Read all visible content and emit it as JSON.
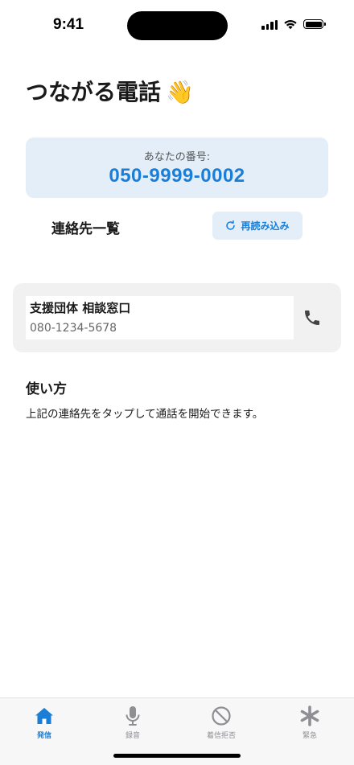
{
  "status_bar": {
    "time": "9:41"
  },
  "app": {
    "title": "つながる電話",
    "title_emoji": "👋"
  },
  "my_number": {
    "label": "あなたの番号:",
    "value": "050-9999-0002"
  },
  "contacts": {
    "heading": "連絡先一覧",
    "reload_label": "再読み込み",
    "items": [
      {
        "name": "支援団体 相談窓口",
        "phone": "080-1234-5678"
      }
    ]
  },
  "usage": {
    "heading": "使い方",
    "text": "上記の連絡先をタップして通話を開始できます。"
  },
  "tab_bar": {
    "tabs": [
      {
        "label": "発信",
        "icon": "home-icon",
        "active": true
      },
      {
        "label": "録音",
        "icon": "microphone-icon",
        "active": false
      },
      {
        "label": "着信拒否",
        "icon": "block-icon",
        "active": false
      },
      {
        "label": "緊急",
        "icon": "asterisk-icon",
        "active": false
      }
    ]
  },
  "colors": {
    "accent": "#1a7ed6",
    "card_bg": "#e3eef9",
    "contact_card_bg": "#f1f1f1",
    "inactive_tab": "#8e8e93"
  }
}
